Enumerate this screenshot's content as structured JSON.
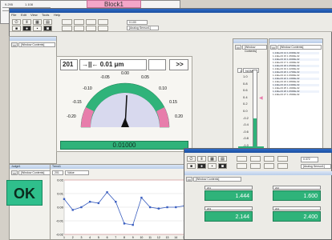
{
  "background_window": {
    "cell_values": [
      "9.295",
      "1.108"
    ],
    "block_label": "Block1"
  },
  "main_window": {
    "menu": [
      "File",
      "Edit",
      "View",
      "Tools",
      "Help"
    ],
    "toolbar": {
      "value_box": "0.100",
      "dropdown_value": "[Analog Sensor1]"
    },
    "panels": {
      "left_select": "[Window Contents]",
      "bar_select": "[Window Contents]",
      "table_select": "[Window Contents]"
    },
    "gauge": {
      "channel": "201",
      "resolution": "→||← 0.01 μm",
      "arrow_button": ">>",
      "ticks": [
        "0.00",
        "-0.05",
        "0.05",
        "-0.10",
        "0.10",
        "-0.15",
        "0.15",
        "-0.20",
        "0.20"
      ],
      "readout": "0.01000",
      "needle_value": 0.01
    },
    "bar_panel": {
      "channel": "1",
      "mode": "NOM",
      "scale": [
        "1.0",
        "0.8",
        "0.6",
        "0.4",
        "0.2",
        "0.0",
        "-0.2",
        "-0.4",
        "-0.6",
        "-0.8",
        "-1.0"
      ],
      "readout": "0.01000",
      "fill_fraction": 0.38
    },
    "table": {
      "rows": [
        "1.14E+03 14 1.2030E-02",
        "1.14E+03 15 1.3500E-02",
        "1.14E+03 16 1.4000E-02",
        "1.14E+03 17 1.1000E-02",
        "1.14E+03 18 1.0500E-02",
        "1.14E+03 19 1.2200E-02",
        "1.14E+03 20 1.1700E-02",
        "1.14E+03 21 1.0900E-02",
        "1.14E+03 22 1.1300E-02",
        "1.14E+03 23 1.0800E-02",
        "1.14E+03 24 1.2400E-02",
        "1.14E+03 25 1.1900E-02",
        "1.14E+03 26 1.0600E-02",
        "1.14E+03 27 1.1500E-02"
      ]
    },
    "ok_panel": {
      "title": "Judge1",
      "select": "[Window Contents]",
      "status": "OK"
    },
    "chart_panel": {
      "title": "Trend1",
      "channel": "201",
      "channel_label": "Value"
    }
  },
  "chart_data": {
    "type": "line",
    "x": [
      1,
      2,
      3,
      4,
      5,
      6,
      7,
      8,
      9,
      10,
      11,
      12,
      13,
      14,
      15
    ],
    "series": [
      {
        "values": [
          0.006,
          -0.002,
          0.0,
          0.004,
          0.003,
          0.011,
          0.004,
          -0.012,
          -0.013,
          0.007,
          0.0,
          -0.001,
          0.0,
          0.0,
          0.001
        ]
      }
    ],
    "ylim": [
      -0.02,
      0.02
    ],
    "ticks_y": [
      "0.02",
      "0.01",
      "0.00",
      "-0.01",
      "-0.02"
    ]
  },
  "front_window": {
    "value_box": "0.372",
    "dropdown_value": "[Analog Sensor1]",
    "select": "[Window Contents]",
    "channels": [
      {
        "tag": "201",
        "value": "1.444"
      },
      {
        "tag": "202",
        "value": "1.600"
      },
      {
        "tag": "203",
        "value": "2.144"
      },
      {
        "tag": "204",
        "value": "2.400"
      }
    ]
  },
  "colors": {
    "accent_green": "#2fb37a",
    "ok_green": "#2fbf8c",
    "block_pink": "#f3a6c8",
    "title_blue": "#2d6bc9"
  }
}
